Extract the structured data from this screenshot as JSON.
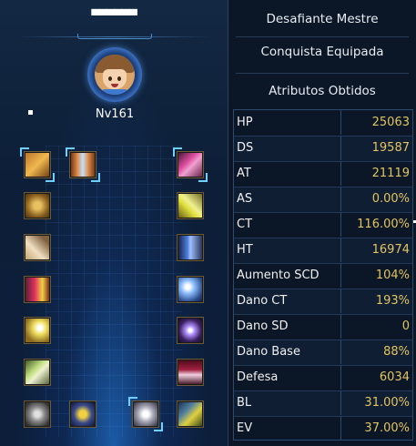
{
  "character": {
    "name": "▀▀▀▀▀▀",
    "level": "Nv161"
  },
  "panel": {
    "title": "Desafiante Mestre",
    "achievement": "Conquista Equipada",
    "attributes_header": "Atributos Obtidos"
  },
  "stats": [
    {
      "label": "HP",
      "value": "25063"
    },
    {
      "label": "DS",
      "value": "19587"
    },
    {
      "label": "AT",
      "value": "21119"
    },
    {
      "label": "AS",
      "value": "0.00%"
    },
    {
      "label": "CT",
      "value": "116.00%"
    },
    {
      "label": "HT",
      "value": "16974"
    },
    {
      "label": "Aumento SCD",
      "value": "104%"
    },
    {
      "label": "Dano CT",
      "value": "193%"
    },
    {
      "label": "Dano SD",
      "value": "0"
    },
    {
      "label": "Dano Base",
      "value": "88%"
    },
    {
      "label": "Defesa",
      "value": "6034"
    },
    {
      "label": "BL",
      "value": "31.00%"
    },
    {
      "label": "EV",
      "value": "37.00%"
    }
  ],
  "equipment_slots": {
    "left": [
      "helmet-icon",
      "fur-accessory-icon",
      "gloves-icon",
      "red-pants-icon",
      "boots-icon",
      "green-gear-icon",
      "chip-icon"
    ],
    "top": [
      "wings-badge-icon"
    ],
    "right": [
      "pink-device-icon",
      "yellow-chip-icon",
      "digivice-icon",
      "crest-orb-icon",
      "purple-ring-icon",
      "seal-card-icon",
      "green-cartridge-icon"
    ],
    "bottom": [
      "gold-emblem-icon",
      "silver-disc-icon"
    ]
  },
  "colors": {
    "stat_value": "#e2c460",
    "stat_label": "#f0f0f0",
    "accent_blue": "#6fd0ff",
    "background": "#0a1628"
  }
}
